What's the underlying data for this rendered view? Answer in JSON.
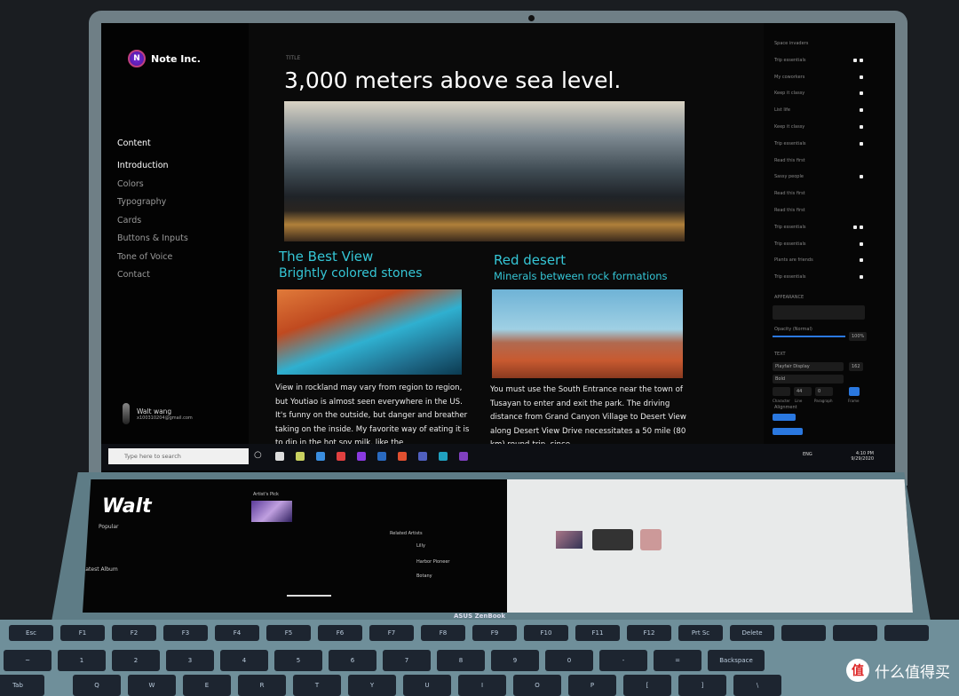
{
  "sidebar": {
    "brand": "Note Inc.",
    "brand_initial": "N",
    "section": "Content",
    "items": [
      "Introduction",
      "Colors",
      "Typography",
      "Cards",
      "Buttons & Inputs",
      "Tone of Voice",
      "Contact"
    ],
    "user": {
      "name": "Walt wang",
      "email": "x100310204@gmail.com"
    }
  },
  "main": {
    "label": "TITLE",
    "title": "3,000 meters above sea level.",
    "card1": {
      "title": "The Best View",
      "subtitle": "Brightly colored stones",
      "body": "View in rockland may vary from region to region, but Youtiao is almost seen everywhere in the US. It's funny on the outside, but danger and breather taking on the inside. My favorite way of eating it is to dip in the hot soy milk, like the"
    },
    "card2": {
      "title": "Red desert",
      "subtitle": "Minerals between rock formations",
      "body": "You must use the South Entrance near the town of Tusayan to enter and exit the park. The driving distance from Grand Canyon Village to Desert View along Desert View Drive necessitates a 50 mile (80 km) round-trip, since"
    }
  },
  "right_panel": {
    "layers": [
      "Space invaders",
      "Trip essentials",
      "My coworkers",
      "Keep it classy",
      "List life",
      "Keep it classy",
      "Trip essentials",
      "Read this first",
      "Sassy people",
      "Read this first",
      "Read this first",
      "Trip essentials",
      "Trip essentials",
      "Plants are friends",
      "Trip essentials"
    ],
    "appearance_label": "APPEARANCE",
    "opacity_label": "Opacity (Normal)",
    "opacity_value": "100%",
    "opacity_percent": 100,
    "text_label": "TEXT",
    "font": "Playfair Display",
    "font_size": "162",
    "weight": "Bold",
    "line": "44",
    "paragraph": "0",
    "char_label": "Character",
    "line_label": "Line",
    "paragraph_label": "Paragraph",
    "frame_label": "Frame",
    "alignment_label": "Alignment"
  },
  "taskbar": {
    "search_placeholder": "Type here to search",
    "lang": "ENG",
    "time": "4:10 PM",
    "date": "9/29/2020"
  },
  "lower_screen": {
    "app_title": "Walt",
    "popular": "Popular",
    "latest": "Latest Album",
    "artists_pick": "Artist's Pick",
    "related": "Related Artists",
    "artists": [
      "Lilly",
      "Harbor Pioneer",
      "Botany"
    ]
  },
  "device": {
    "brand": "ASUS ZenBook"
  },
  "keyboard": {
    "keys": [
      "Esc",
      "F1",
      "F2",
      "F3",
      "F4",
      "F5",
      "F6",
      "F7",
      "F8",
      "F9",
      "F10",
      "F11",
      "F12",
      "Prt Sc",
      "Delete",
      "",
      "",
      "",
      "~",
      "1",
      "2",
      "3",
      "4",
      "5",
      "6",
      "7",
      "8",
      "9",
      "0",
      "-",
      "=",
      "Backspace",
      "Tab",
      "Q",
      "W",
      "E",
      "R",
      "T",
      "Y",
      "U",
      "I",
      "O",
      "P",
      "[",
      "]",
      "\\"
    ]
  },
  "watermark": {
    "text": "什么值得买",
    "icon": "值"
  },
  "colors": {
    "accent": "#35c6d6",
    "blue": "#2a78e0"
  }
}
